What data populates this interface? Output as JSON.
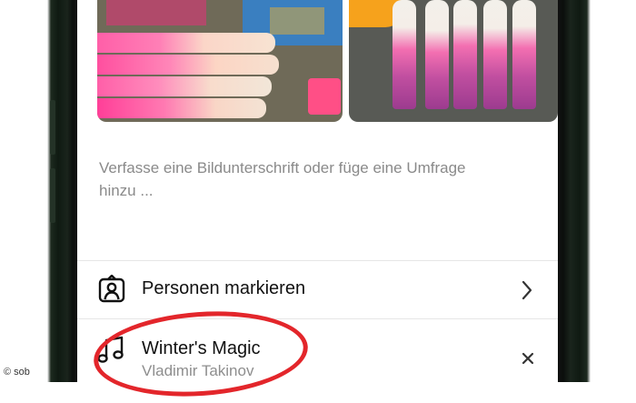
{
  "composer": {
    "caption_placeholder": "Verfasse eine Bildunterschrift oder füge eine Umfrage hinzu ..."
  },
  "options": {
    "tag_people_label": "Personen markieren",
    "tag_people_icon": "person-tag-icon",
    "chevron_icon": "chevron-right-icon"
  },
  "music": {
    "title": "Winter's Magic",
    "artist": "Vladimir Takinov",
    "icon": "music-note-icon",
    "remove_icon": "close-icon"
  },
  "annotation": {
    "color": "#e3262b"
  },
  "credit": "© sob"
}
